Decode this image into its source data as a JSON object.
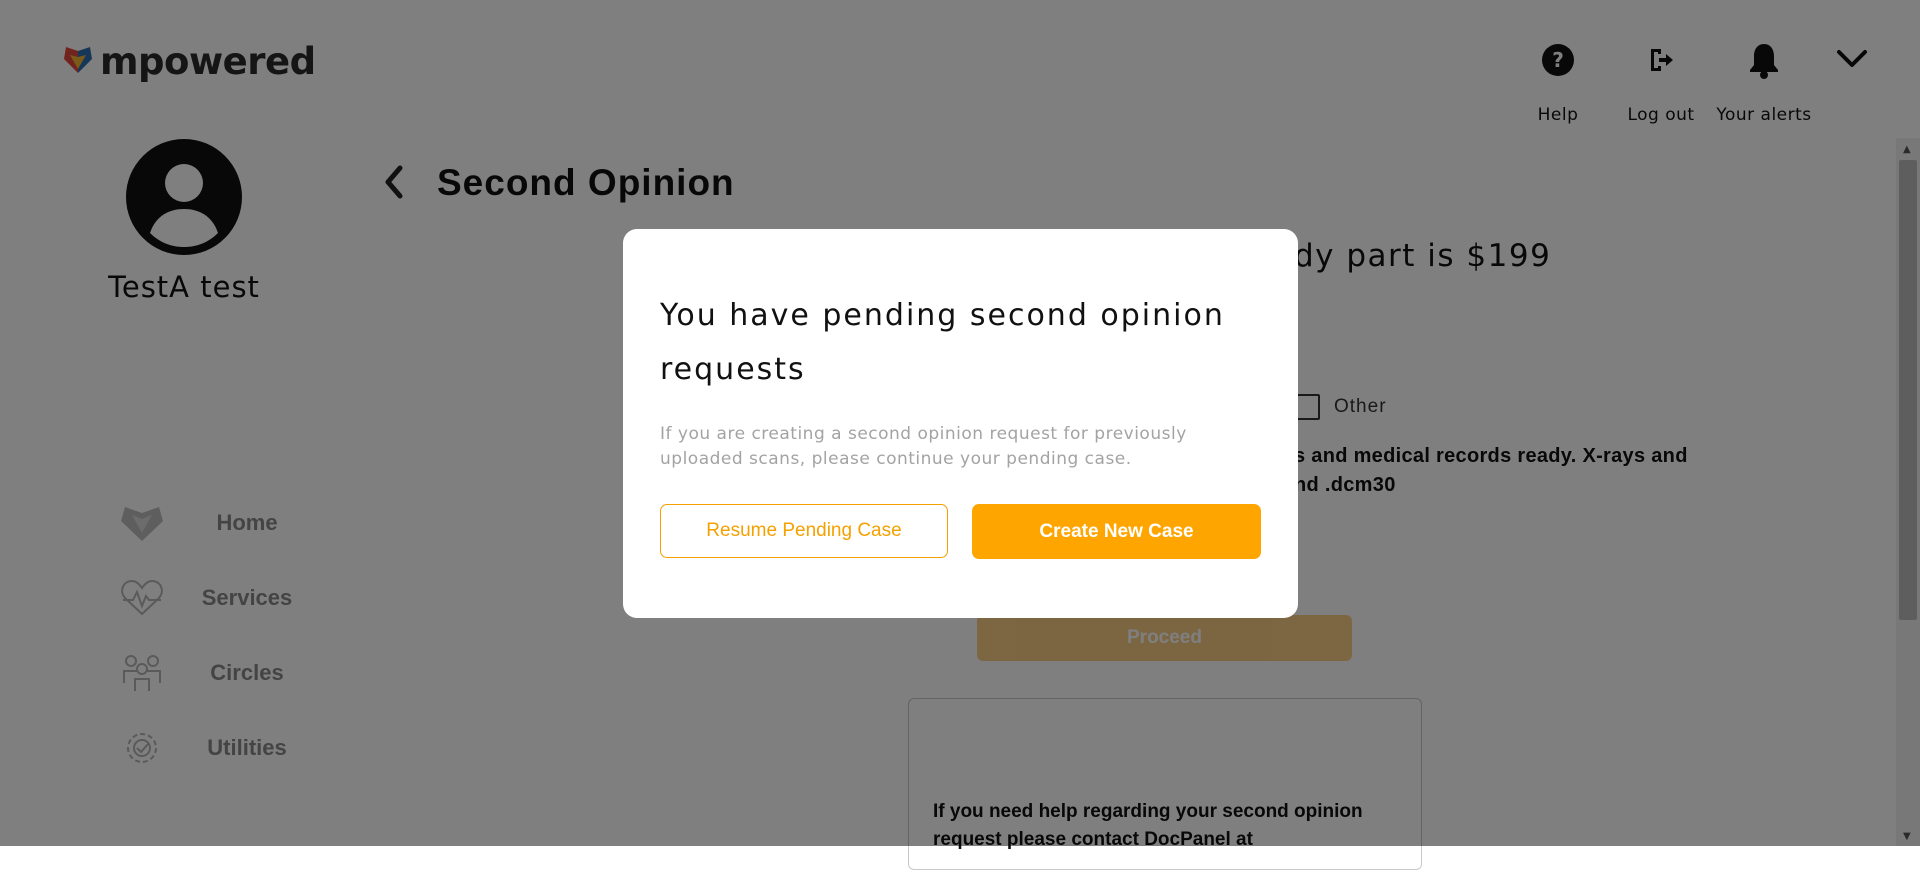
{
  "header": {
    "logo_text": "mpowered",
    "nav": [
      {
        "label": "Help",
        "icon": "help-icon"
      },
      {
        "label": "Log out",
        "icon": "logout-icon"
      },
      {
        "label": "Your alerts",
        "icon": "bell-icon"
      }
    ],
    "menu_icon": "chevron-down-icon"
  },
  "sidebar": {
    "user_name": "TestA test",
    "items": [
      {
        "label": "Home",
        "icon": "home-icon"
      },
      {
        "label": "Services",
        "icon": "services-icon"
      },
      {
        "label": "Circles",
        "icon": "circles-icon"
      },
      {
        "label": "Utilities",
        "icon": "utilities-icon"
      }
    ]
  },
  "main": {
    "title": "Second Opinion",
    "price_partial": "dy part is $199",
    "checkbox_label": "Other",
    "info_partial": "s and medical records ready. X-rays and\nnd .dcm30",
    "proceed_label": "Proceed",
    "help_text": "If you need help regarding your second opinion request please contact DocPanel at"
  },
  "modal": {
    "title": "You have pending second opinion requests",
    "description": "If you are creating a second opinion request for previously uploaded scans, please continue your pending case.",
    "resume_label": "Resume Pending Case",
    "create_label": "Create New Case"
  },
  "colors": {
    "accent": "#ffa500",
    "overlay": "rgba(0,0,0,0.5)"
  }
}
